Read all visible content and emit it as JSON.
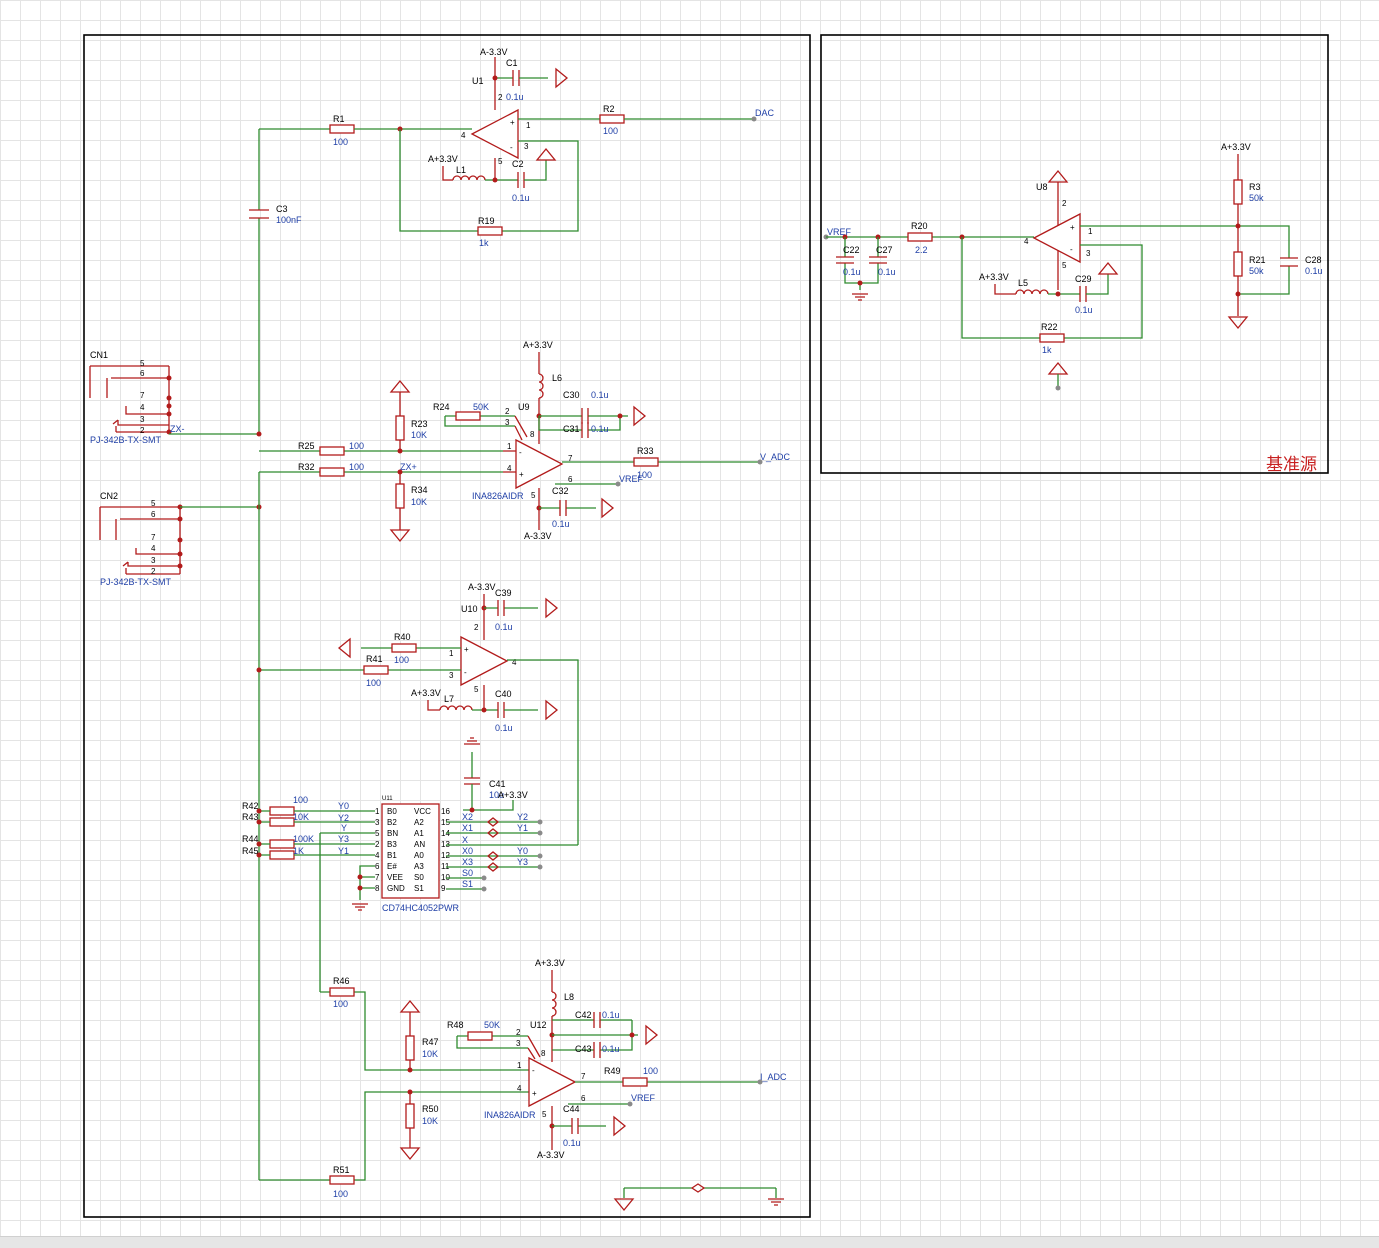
{
  "ref_section_label": "基准源",
  "nets": {
    "a33p": "A+3.3V",
    "a33n": "A-3.3V",
    "dac": "DAC",
    "v_adc": "V_ADC",
    "i_adc": "I_ADC",
    "vref": "VREF",
    "zxm": "ZX-",
    "zxp": "ZX+"
  },
  "parts": {
    "U1": "U1",
    "U8": "U8",
    "U9": "U9",
    "U10": "U10",
    "U11": "U11",
    "U12": "U12",
    "C1": "C1",
    "C2": "C2",
    "C3": "C3",
    "C22": "C22",
    "C27": "C27",
    "C28": "C28",
    "C29": "C29",
    "C30": "C30",
    "C31": "C31",
    "C32": "C32",
    "C39": "C39",
    "C40": "C40",
    "C41": "C41",
    "C42": "C42",
    "C43": "C43",
    "C44": "C44",
    "R1": "R1",
    "R2": "R2",
    "R3": "R3",
    "R19": "R19",
    "R20": "R20",
    "R21": "R21",
    "R22": "R22",
    "R23": "R23",
    "R24": "R24",
    "R25": "R25",
    "R32": "R32",
    "R33": "R33",
    "R34": "R34",
    "R40": "R40",
    "R41": "R41",
    "R42": "R42",
    "R43": "R43",
    "R44": "R44",
    "R45": "R45",
    "R46": "R46",
    "R47": "R47",
    "R48": "R48",
    "R49": "R49",
    "R50": "R50",
    "R51": "R51",
    "L1": "L1",
    "L5": "L5",
    "L6": "L6",
    "L7": "L7",
    "L8": "L8",
    "CN1": "CN1",
    "CN2": "CN2"
  },
  "values": {
    "v01u": "0.1u",
    "v100": "100",
    "v100nF": "100nF",
    "v1k": "1k",
    "v1K": "1K",
    "v50k": "50k",
    "v50K": "50K",
    "v10K": "10K",
    "v2_2": "2.2",
    "v100K": "100K",
    "v10u": "10u",
    "ina": "INA826AIDR",
    "mux": "CD74HC4052PWR",
    "jack": "PJ-342B-TX-SMT"
  },
  "pins": {
    "p1": "1",
    "p2": "2",
    "p3": "3",
    "p4": "4",
    "p5": "5",
    "p6": "6",
    "p7": "7",
    "p8": "8",
    "p9": "9",
    "p10": "10",
    "p11": "11",
    "p12": "12",
    "p13": "13",
    "p14": "14",
    "p15": "15",
    "p16": "16",
    "plus": "+",
    "minus": "-"
  },
  "mux_pins": {
    "left": [
      "B0",
      "B2",
      "BN",
      "B3",
      "B1",
      "E#",
      "VEE",
      "GND"
    ],
    "right": [
      "VCC",
      "A2",
      "A1",
      "AN",
      "A0",
      "A3",
      "S0",
      "S1"
    ]
  },
  "mux_nets": {
    "y0": "Y0",
    "y1": "Y1",
    "y2": "Y2",
    "y3": "Y3",
    "y": "Y",
    "x": "X",
    "x0": "X0",
    "x1": "X1",
    "x2": "X2",
    "x3": "X3",
    "s0": "S0",
    "s1": "S1"
  }
}
